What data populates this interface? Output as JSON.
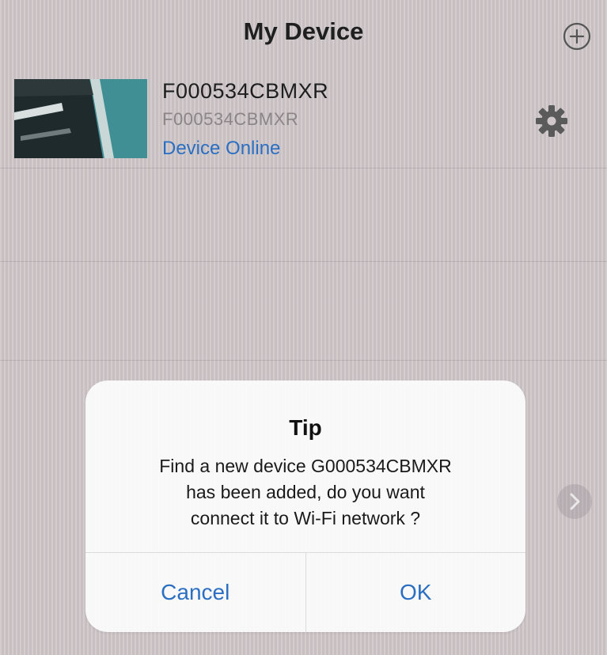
{
  "header": {
    "title": "My Device",
    "add_icon": "plus-circle-icon"
  },
  "device": {
    "name": "F000534CBMXR",
    "id": "F000534CBMXR",
    "status": "Device Online",
    "settings_icon": "gear-icon"
  },
  "dialog": {
    "title": "Tip",
    "message_lines": [
      "Find a new device G000534CBMXR",
      "has been added, do you want",
      "connect it to Wi-Fi network ?"
    ],
    "cancel_label": "Cancel",
    "ok_label": "OK"
  },
  "colors": {
    "accent": "#2b6fc2",
    "title_text": "#1f1f1f",
    "secondary_text": "#8b8588",
    "dialog_bg": "#fafafa"
  }
}
